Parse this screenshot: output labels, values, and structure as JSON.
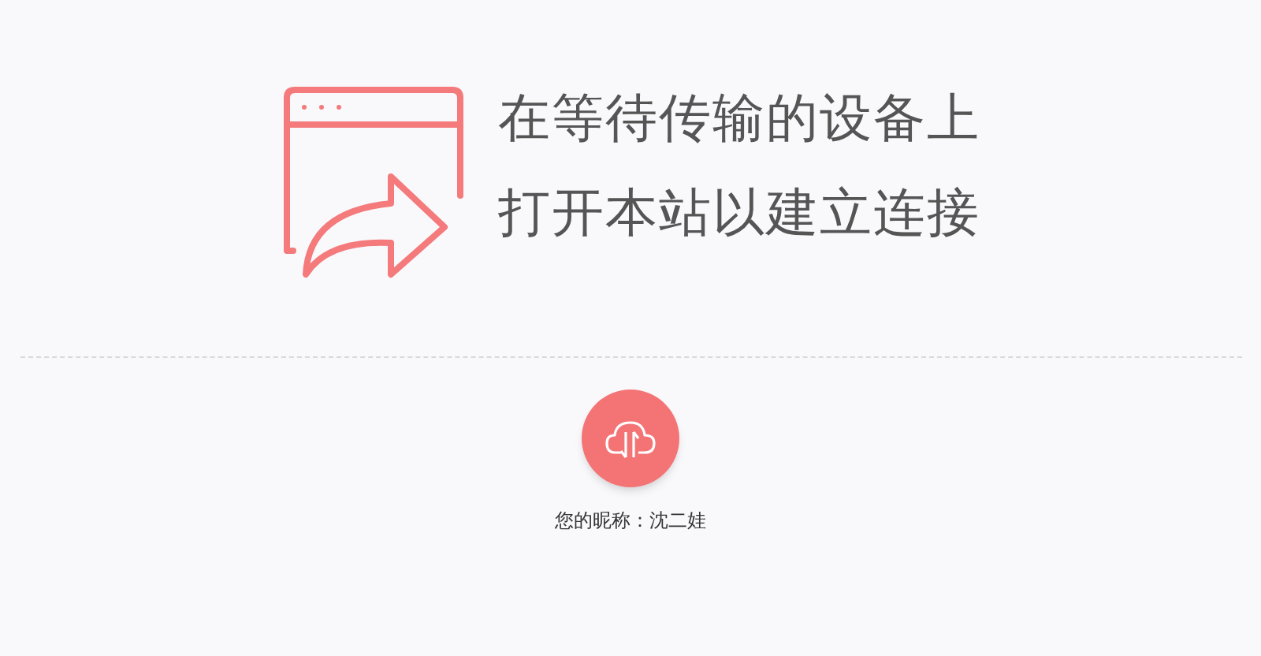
{
  "message": {
    "lines": [
      "在等待传输的设备上",
      "打开本站以建立连接"
    ]
  },
  "nickname": {
    "text": "您的昵称：沈二娃"
  }
}
